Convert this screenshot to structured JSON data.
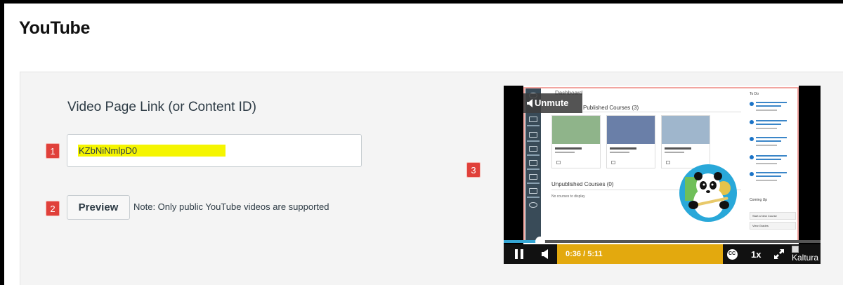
{
  "page": {
    "title": "YouTube"
  },
  "form": {
    "field_label": "Video Page Link (or Content ID)",
    "input_value": "KZbNiNmlpD0",
    "preview_label": "Preview",
    "note": "Note: Only public YouTube videos are supported"
  },
  "badges": {
    "one": "1",
    "two": "2",
    "three": "3"
  },
  "player": {
    "unmute_label": "Unmute",
    "current_time": "0:36",
    "duration": "/ 5:11",
    "progress_fraction": 0.116,
    "speed_label": "1x",
    "logo_alt": "Kaltura",
    "cc_label": "CC",
    "colors": {
      "accent": "#e3a90e",
      "progress": "#35a6d4"
    },
    "icons": [
      "pause-icon",
      "volume-icon",
      "closed-captions-icon",
      "fullscreen-icon"
    ],
    "screenshot": {
      "dashboard_title": "Dashboard",
      "published_title": "Published Courses (3)",
      "unpublished_title": "Unpublished Courses (0)",
      "unpublished_text": "No courses to display",
      "todo_title": "To Do",
      "coming_up": "Coming Up",
      "start_course": "Start a New Course",
      "view_grades": "View Grades"
    }
  }
}
